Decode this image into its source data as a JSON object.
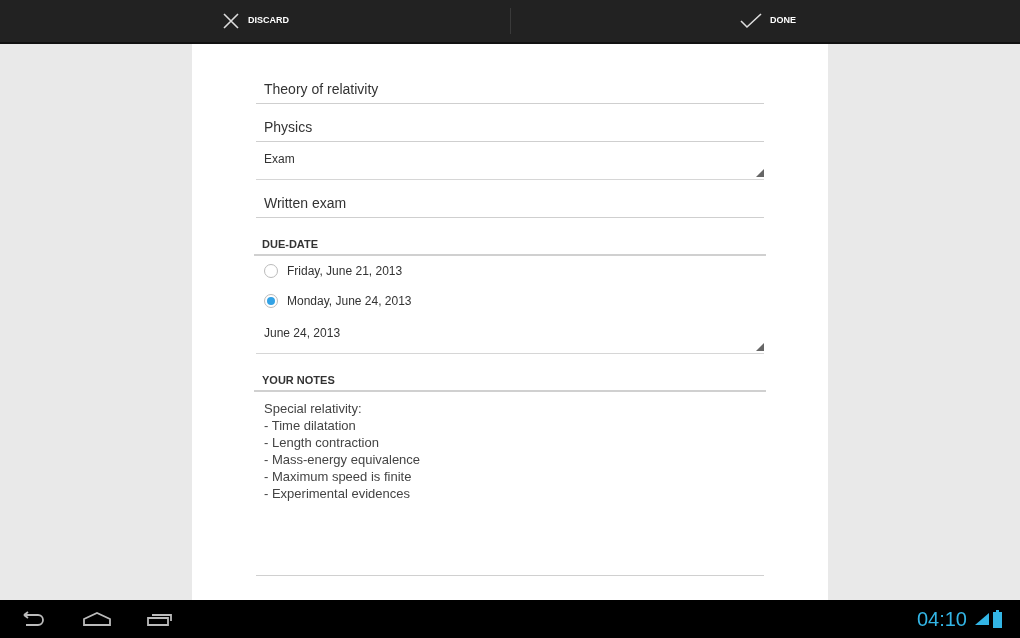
{
  "action_bar": {
    "discard": "DISCARD",
    "done": "DONE"
  },
  "form": [
    {
      "kind": "text",
      "value": "Theory of relativity"
    },
    {
      "kind": "text",
      "value": "Physics"
    },
    {
      "kind": "spinner",
      "value": "Exam"
    },
    {
      "kind": "text",
      "value": "Written exam"
    },
    {
      "kind": "header",
      "label": "DUE-DATE"
    },
    {
      "kind": "radio",
      "label": "Friday, June 21, 2013",
      "selected": false
    },
    {
      "kind": "radio",
      "label": "Monday, June 24, 2013",
      "selected": true
    },
    {
      "kind": "spinner",
      "value": "June 24, 2013"
    },
    {
      "kind": "header",
      "label": "YOUR NOTES"
    },
    {
      "kind": "notes",
      "value": "Special relativity:\n- Time dilatation\n- Length contraction\n- Mass-energy equivalence\n- Maximum speed is finite\n- Experimental evidences"
    }
  ],
  "status_bar": {
    "clock": "04:10"
  }
}
